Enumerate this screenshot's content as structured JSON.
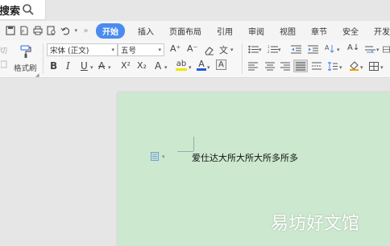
{
  "search": {
    "label": "搜索"
  },
  "tabs": [
    {
      "label": "开始",
      "active": true
    },
    {
      "label": "插入"
    },
    {
      "label": "页面布局"
    },
    {
      "label": "引用"
    },
    {
      "label": "审阅"
    },
    {
      "label": "视图"
    },
    {
      "label": "章节"
    },
    {
      "label": "安全"
    },
    {
      "label": "开发"
    }
  ],
  "ribbon": {
    "format_painter_label": "格式刷",
    "font_name": "宋体 (正文)",
    "font_size": "五号",
    "cut_label": "切",
    "glyph_grow": "A⁺",
    "glyph_shrink": "A⁻",
    "glyph_bold": "B",
    "glyph_italic": "I",
    "glyph_underline": "U",
    "glyph_strike": "A",
    "glyph_superscript": "X²",
    "glyph_subscript": "X₂",
    "glyph_font_effect": "A",
    "glyph_highlight": "ab",
    "glyph_font_color": "A",
    "glyph_char_border": "A",
    "glyph_phonetic": "文",
    "glyph_sort": "A↓",
    "accent_color": "#4a8bef",
    "font_color_bar": "#1e5bd6",
    "highlight_bar": "#f2e500"
  },
  "document": {
    "body_text": "爱仕达大所大所大所多所多",
    "page_color": "#cce8cf"
  },
  "watermark": "易坊好文馆"
}
